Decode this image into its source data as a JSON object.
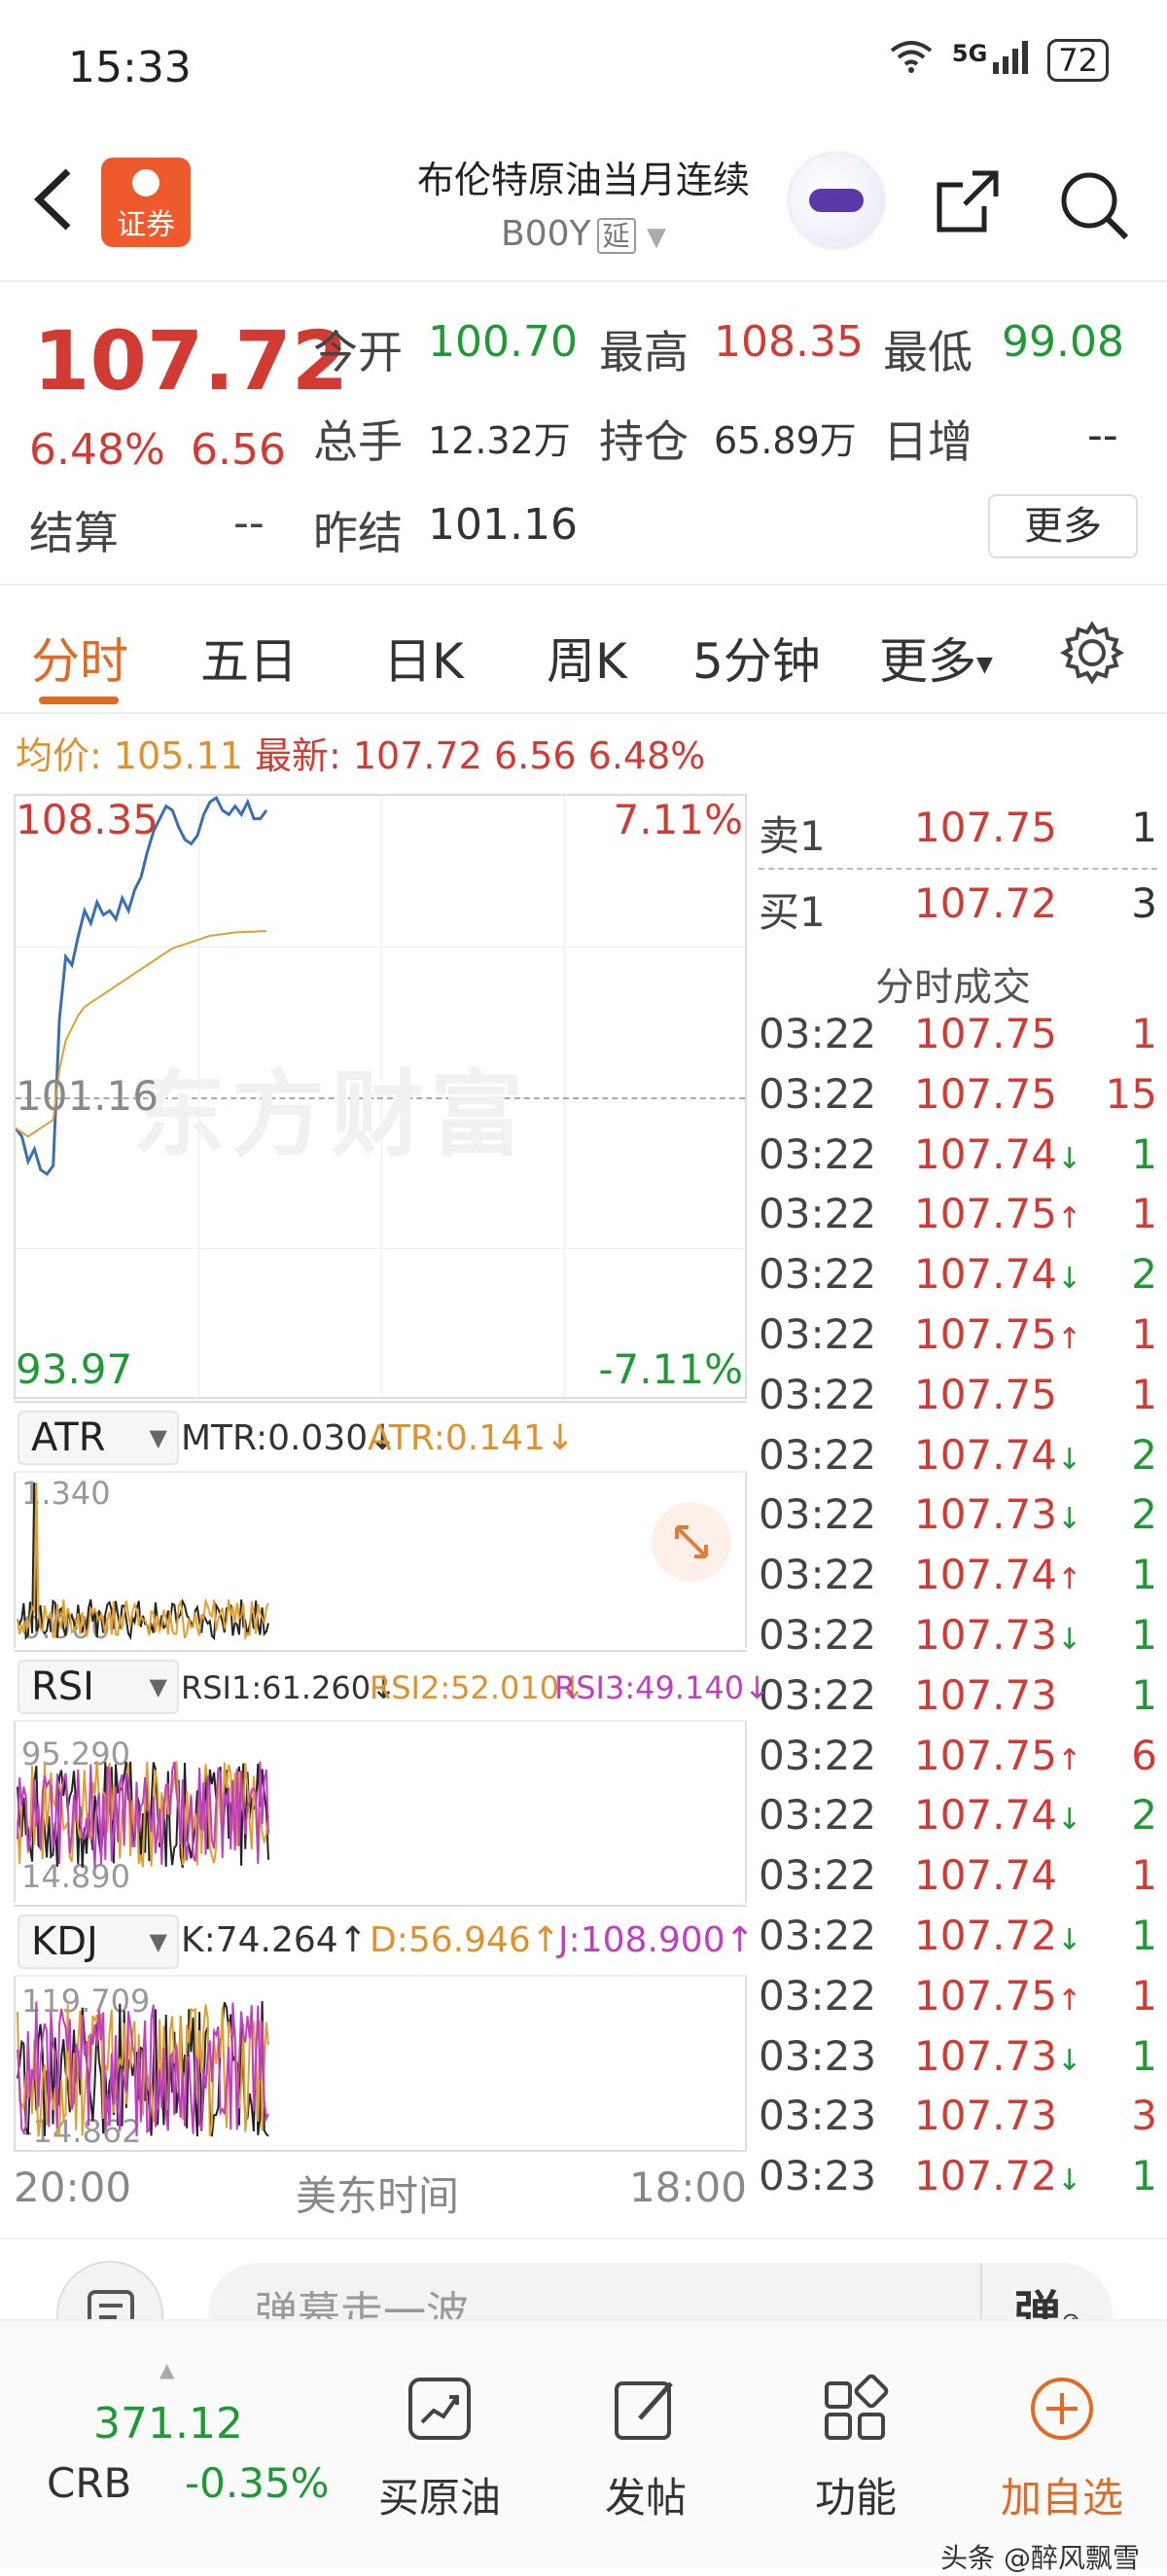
{
  "status": {
    "time": "15:33",
    "network": "5G",
    "battery": "72"
  },
  "header": {
    "title": "布伦特原油当月连续",
    "code": "B00Y",
    "delay_tag": "延",
    "logo_text": "证券"
  },
  "quote": {
    "price": "107.72",
    "pct": "6.48%",
    "change": "6.56",
    "open_label": "今开",
    "open": "100.70",
    "high_label": "最高",
    "high": "108.35",
    "low_label": "最低",
    "low": "99.08",
    "volume_label": "总手",
    "volume": "12.32万",
    "oi_label": "持仓",
    "oi": "65.89万",
    "daily_inc_label": "日增",
    "daily_inc": "--",
    "settle_label": "结算",
    "settle": "--",
    "prev_settle_label": "昨结",
    "prev_settle": "101.16",
    "more": "更多"
  },
  "tabs": [
    "分时",
    "五日",
    "日K",
    "周K",
    "5分钟",
    "更多"
  ],
  "infoline": {
    "avg_label": "均价:",
    "avg": "105.11",
    "latest_label": "最新:",
    "latest": "107.72",
    "chg": "6.56",
    "pct": "6.48%"
  },
  "chart": {
    "top_price": "108.35",
    "top_pct": "7.11%",
    "mid_price": "101.16",
    "bottom_price": "93.97",
    "bottom_pct": "-7.11%",
    "watermark": "东方财富",
    "colors": {
      "price_line": "#3a6fb5",
      "avg_line": "#e0a030",
      "up": "#d23b34",
      "down": "#1e9a34"
    }
  },
  "chart_data": {
    "type": "line",
    "title": "",
    "xlabel": "",
    "ylabel": "",
    "ylim": [
      93.97,
      108.35
    ],
    "series": [
      {
        "name": "",
        "values": [
          100.4,
          100.2,
          99.6,
          99.9,
          99.4,
          99.3,
          99.5,
          103.0,
          104.5,
          104.3,
          105.0,
          105.6,
          105.3,
          105.8,
          105.5,
          105.6,
          105.4,
          105.9,
          105.6,
          106.1,
          106.4,
          107.0,
          107.5,
          107.8,
          108.1,
          108.0,
          107.6,
          107.3,
          107.2,
          107.4,
          107.9,
          108.2,
          108.3,
          108.0,
          107.9,
          108.1,
          107.9,
          108.2,
          107.8,
          107.8,
          108.0
        ]
      },
      {
        "name": "",
        "values": [
          100.4,
          100.3,
          100.2,
          100.3,
          100.4,
          100.5,
          100.6,
          101.8,
          102.5,
          102.8,
          103.1,
          103.3,
          103.4,
          103.5,
          103.6,
          103.7,
          103.8,
          103.9,
          104.0,
          104.1,
          104.2,
          104.3,
          104.4,
          104.5,
          104.6,
          104.7,
          104.75,
          104.8,
          104.85,
          104.9,
          104.95,
          105.0,
          105.02,
          105.04,
          105.06,
          105.08,
          105.09,
          105.1,
          105.1,
          105.11,
          105.11
        ]
      }
    ]
  },
  "orderbook": {
    "sell_label": "卖1",
    "sell_price": "107.75",
    "sell_vol": "1",
    "buy_label": "买1",
    "buy_price": "107.72",
    "buy_vol": "3",
    "trades_title": "分时成交",
    "trades": [
      {
        "t": "03:22",
        "p": "107.75",
        "d": "",
        "v": "1",
        "c": "red"
      },
      {
        "t": "03:22",
        "p": "107.75",
        "d": "",
        "v": "15",
        "c": "red"
      },
      {
        "t": "03:22",
        "p": "107.74",
        "d": "↓",
        "v": "1",
        "c": "green"
      },
      {
        "t": "03:22",
        "p": "107.75",
        "d": "↑",
        "v": "1",
        "c": "red"
      },
      {
        "t": "03:22",
        "p": "107.74",
        "d": "↓",
        "v": "2",
        "c": "green"
      },
      {
        "t": "03:22",
        "p": "107.75",
        "d": "↑",
        "v": "1",
        "c": "red"
      },
      {
        "t": "03:22",
        "p": "107.75",
        "d": "",
        "v": "1",
        "c": "red"
      },
      {
        "t": "03:22",
        "p": "107.74",
        "d": "↓",
        "v": "2",
        "c": "green"
      },
      {
        "t": "03:22",
        "p": "107.73",
        "d": "↓",
        "v": "2",
        "c": "green"
      },
      {
        "t": "03:22",
        "p": "107.74",
        "d": "↑",
        "v": "1",
        "c": "green"
      },
      {
        "t": "03:22",
        "p": "107.73",
        "d": "↓",
        "v": "1",
        "c": "green"
      },
      {
        "t": "03:22",
        "p": "107.73",
        "d": "",
        "v": "1",
        "c": "green"
      },
      {
        "t": "03:22",
        "p": "107.75",
        "d": "↑",
        "v": "6",
        "c": "red"
      },
      {
        "t": "03:22",
        "p": "107.74",
        "d": "↓",
        "v": "2",
        "c": "green"
      },
      {
        "t": "03:22",
        "p": "107.74",
        "d": "",
        "v": "1",
        "c": "red"
      },
      {
        "t": "03:22",
        "p": "107.72",
        "d": "↓",
        "v": "1",
        "c": "green"
      },
      {
        "t": "03:22",
        "p": "107.75",
        "d": "↑",
        "v": "1",
        "c": "red"
      },
      {
        "t": "03:23",
        "p": "107.73",
        "d": "↓",
        "v": "1",
        "c": "green"
      },
      {
        "t": "03:23",
        "p": "107.73",
        "d": "",
        "v": "3",
        "c": "red"
      },
      {
        "t": "03:23",
        "p": "107.72",
        "d": "↓",
        "v": "1",
        "c": "green"
      }
    ]
  },
  "indicators": {
    "atr": {
      "name": "ATR",
      "mtr": "MTR:0.030↓",
      "atr": "ATR:0.141↓",
      "top": "1.340",
      "bottom": "0.000"
    },
    "rsi": {
      "name": "RSI",
      "rsi1": "RSI1:61.260↓",
      "rsi2": "RSI2:52.010↓",
      "rsi3": "RSI3:49.140↓",
      "top": "95.290",
      "bottom": "14.890"
    },
    "kdj": {
      "name": "KDJ",
      "k": "K:74.264↑",
      "d": "D:56.946↑",
      "j": "J:108.900↑",
      "top": "119.709",
      "bottom": "-14.862"
    }
  },
  "axis": {
    "start": "20:00",
    "mid": "美东时间",
    "end": "18:00"
  },
  "comment": {
    "placeholder": "弹幕走一波...",
    "danmu_btn": "弹"
  },
  "bottomnav": {
    "crb_value": "371.12",
    "crb_label": "CRB",
    "crb_pct": "-0.35%",
    "items": [
      "买原油",
      "发帖",
      "功能",
      "加自选"
    ]
  },
  "watermark": "头条 @醉风飘雪"
}
